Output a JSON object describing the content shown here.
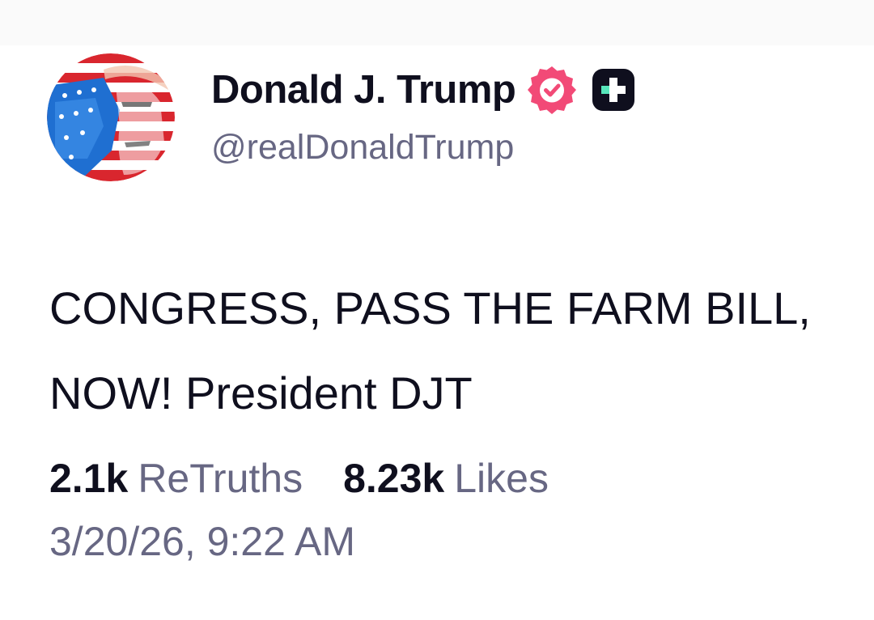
{
  "post": {
    "author": {
      "display_name": "Donald J. Trump",
      "handle": "@realDonaldTrump",
      "avatar_icon": "avatar-flag-portrait",
      "verified_icon": "verified-badge-icon",
      "verified_color": "#f24a77",
      "plus_icon": "plus-badge-icon"
    },
    "text": "CONGRESS, PASS THE FARM BILL, NOW! President DJT",
    "stats": {
      "retruths_count": "2.1k",
      "retruths_label": "ReTruths",
      "likes_count": "8.23k",
      "likes_label": "Likes"
    },
    "timestamp": "3/20/26, 9:22 AM"
  },
  "colors": {
    "text_primary": "#0f0f1e",
    "text_secondary": "#676783",
    "accent": "#f24a77",
    "plus_badge_bg": "#0f0f1e",
    "plus_badge_green": "#57e6bb"
  }
}
